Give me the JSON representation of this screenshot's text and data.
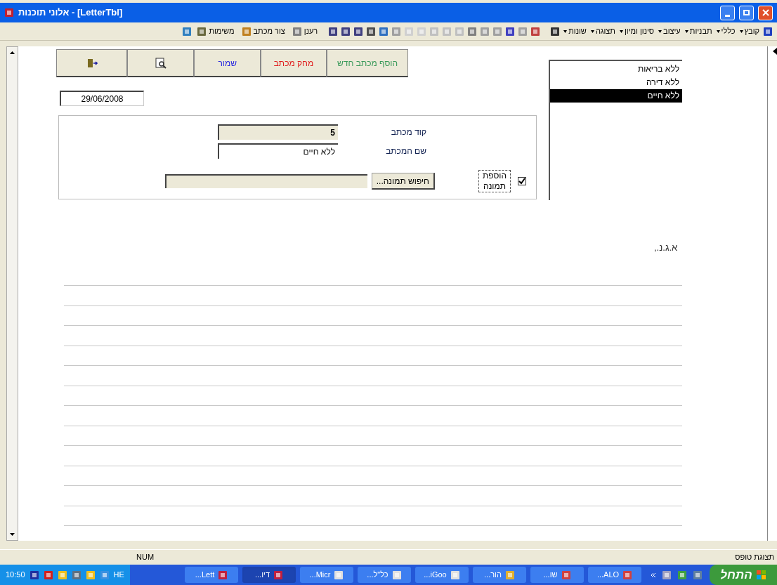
{
  "window": {
    "title": "אלוני תוכנות - [LetterTbl]"
  },
  "menus": [
    "קובץ",
    "כללי",
    "תבניות",
    "עיצוב",
    "סינון ומיון",
    "תצוגה",
    "שונות"
  ],
  "toolbar_buttons": [
    "רענן",
    "צור מכתב",
    "משימות"
  ],
  "form_buttons": [
    {
      "kind": "text",
      "label": "הוסף מכתב חדש",
      "color": "#3a9a5a"
    },
    {
      "kind": "text",
      "label": "מחק מכתב",
      "color": "#e02020"
    },
    {
      "kind": "text",
      "label": "שמור",
      "color": "#2a2ae0"
    },
    {
      "kind": "preview"
    },
    {
      "kind": "exit"
    }
  ],
  "date": "29/06/2008",
  "letters_list": [
    {
      "label": "ללא בריאות",
      "selected": false
    },
    {
      "label": "ללא דירה",
      "selected": false
    },
    {
      "label": "ללא חיים",
      "selected": true
    }
  ],
  "fields": [
    {
      "label": "קוד מכתב",
      "value": "5",
      "locked": true
    },
    {
      "label": "שם המכתב",
      "value": "ללא חיים",
      "locked": false
    }
  ],
  "add_picture": {
    "label": "הוספת תמונה",
    "checked": true
  },
  "browse_button": "חיפוש תמונה...",
  "greeting": "א.ג.נ.,",
  "status_bar": {
    "view": "תצוגת טופס",
    "num": "NUM"
  },
  "taskbar": {
    "start": "התחל",
    "buttons": [
      {
        "label": "ALO...",
        "selected": false
      },
      {
        "label": "שו...",
        "selected": false
      },
      {
        "label": "הור...",
        "selected": false
      },
      {
        "label": "iGoo...",
        "selected": false
      },
      {
        "label": "כל\"ל...",
        "selected": false
      },
      {
        "label": "Micr...",
        "selected": false
      },
      {
        "label": "דיו...",
        "selected": true
      },
      {
        "label": "Lett...",
        "selected": false
      }
    ],
    "language": "HE",
    "clock": "10:50"
  }
}
